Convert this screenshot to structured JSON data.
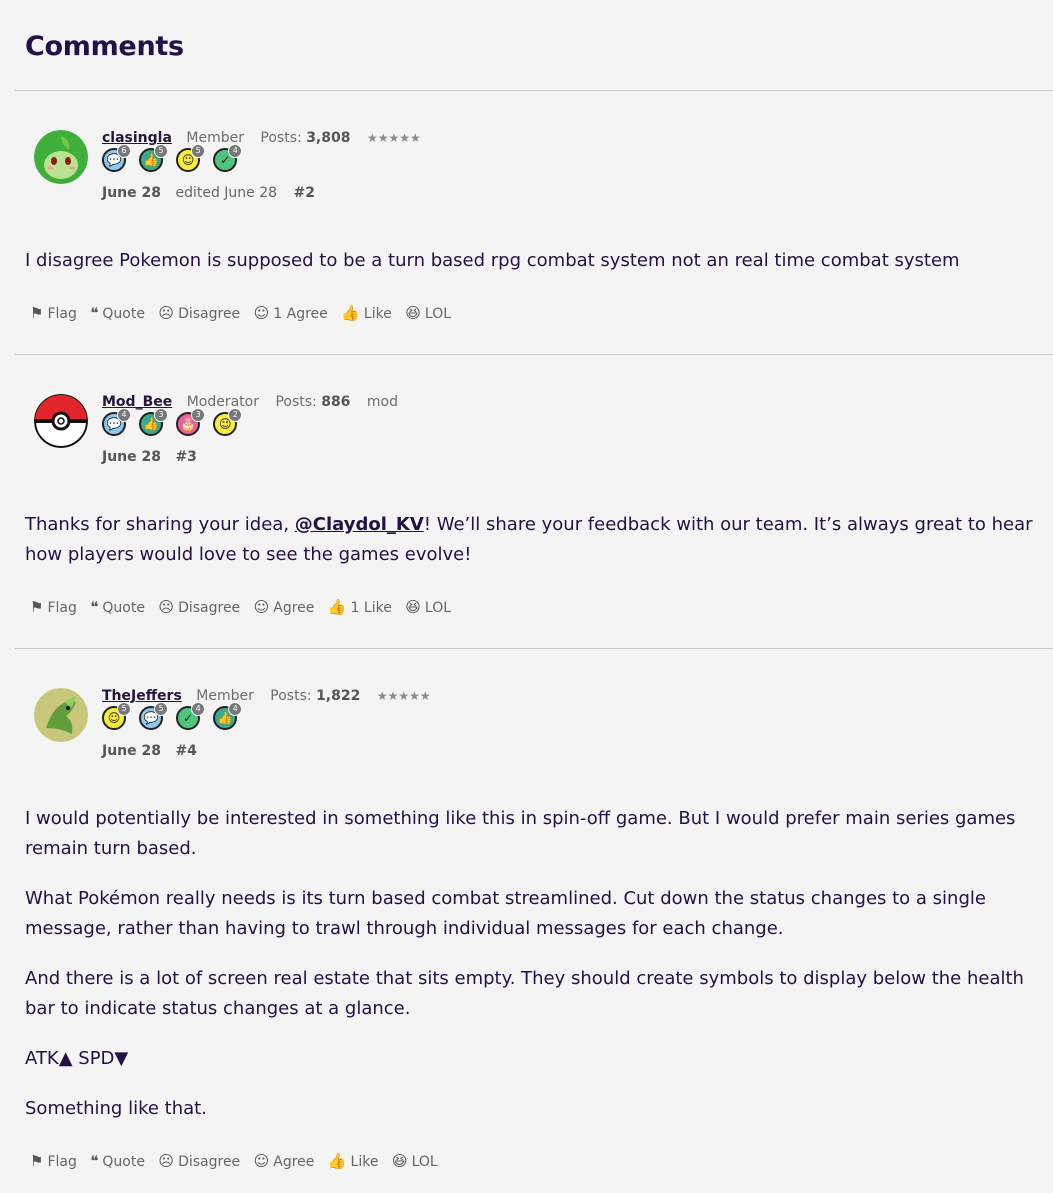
{
  "heading": "Comments",
  "comments": [
    {
      "user": "clasingla",
      "role": "Member",
      "posts_label": "Posts:",
      "posts": "3,808",
      "stars": "★★★★★",
      "extra": "",
      "badges": [
        {
          "type": "comment",
          "count": "6"
        },
        {
          "type": "thumb",
          "count": "5"
        },
        {
          "type": "smile",
          "count": "5"
        },
        {
          "type": "check",
          "count": "4"
        }
      ],
      "date": "June 28",
      "edited": "edited June 28",
      "number": "#2",
      "paragraphs": [
        "I disagree Pokemon is supposed to be a turn based rpg combat system not an real time combat system"
      ],
      "actions": {
        "flag": "Flag",
        "quote": "Quote",
        "disagree": "Disagree",
        "agree": "1 Agree",
        "like": "Like",
        "lol": "LOL"
      }
    },
    {
      "user": "Mod_Bee",
      "role": "Moderator",
      "posts_label": "Posts:",
      "posts": "886",
      "stars": "",
      "extra": "mod",
      "badges": [
        {
          "type": "comment",
          "count": "4"
        },
        {
          "type": "thumb",
          "count": "3"
        },
        {
          "type": "cake",
          "count": "3"
        },
        {
          "type": "wink",
          "count": "2"
        }
      ],
      "date": "June 28",
      "edited": "",
      "number": "#3",
      "body_prefix": "Thanks for sharing your idea, ",
      "mention": "@Claydol_KV",
      "body_suffix": "! We’ll share your feedback with our team. It’s always great to hear how players would love to see the games evolve!",
      "actions": {
        "flag": "Flag",
        "quote": "Quote",
        "disagree": "Disagree",
        "agree": "Agree",
        "like": "1 Like",
        "lol": "LOL"
      }
    },
    {
      "user": "TheJeffers",
      "role": "Member",
      "posts_label": "Posts:",
      "posts": "1,822",
      "stars": "★★★★★",
      "extra": "",
      "badges": [
        {
          "type": "smile",
          "count": "5"
        },
        {
          "type": "comment",
          "count": "5"
        },
        {
          "type": "check",
          "count": "4"
        },
        {
          "type": "thumb",
          "count": "4"
        }
      ],
      "date": "June 28",
      "edited": "",
      "number": "#4",
      "paragraphs": [
        "I would potentially be interested in something like this in spin-off game. But I would prefer main series games remain turn based.",
        "What Pokémon really needs is its turn based combat streamlined. Cut down the status changes to a single message, rather than having to trawl through individual messages for each change.",
        "And there is a lot of screen real estate that sits empty. They should create symbols to display below the health bar to indicate status changes at a glance.",
        "ATK▲ SPD▼",
        "Something like that."
      ],
      "actions": {
        "flag": "Flag",
        "quote": "Quote",
        "disagree": "Disagree",
        "agree": "Agree",
        "like": "Like",
        "lol": "LOL"
      }
    }
  ]
}
